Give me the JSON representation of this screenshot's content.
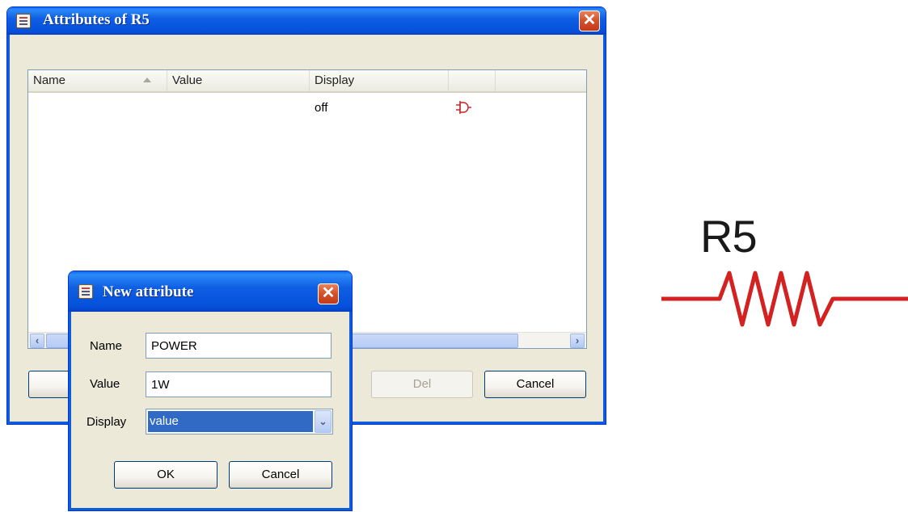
{
  "attributes_dialog": {
    "title": "Attributes of R5",
    "close_glyph": "✕",
    "columns": [
      "Name",
      "Value",
      "Display",
      ""
    ],
    "rows": [
      {
        "name": "",
        "value": "",
        "display": "off",
        "icon": "logic-gate-icon"
      }
    ],
    "buttons": {
      "add": "",
      "del": "Del",
      "cancel": "Cancel"
    },
    "scroll_left_glyph": "‹",
    "scroll_right_glyph": "›"
  },
  "new_attribute_dialog": {
    "title": "New attribute",
    "close_glyph": "✕",
    "name_label": "Name",
    "name_value": "POWER",
    "value_label": "Value",
    "value_value": "1W",
    "display_label": "Display",
    "display_selected": "value",
    "combo_arrow_glyph": "⌄",
    "ok_label": "OK",
    "cancel_label": "Cancel"
  },
  "schematic": {
    "component_ref": "R5",
    "wire_color": "#d42121"
  }
}
